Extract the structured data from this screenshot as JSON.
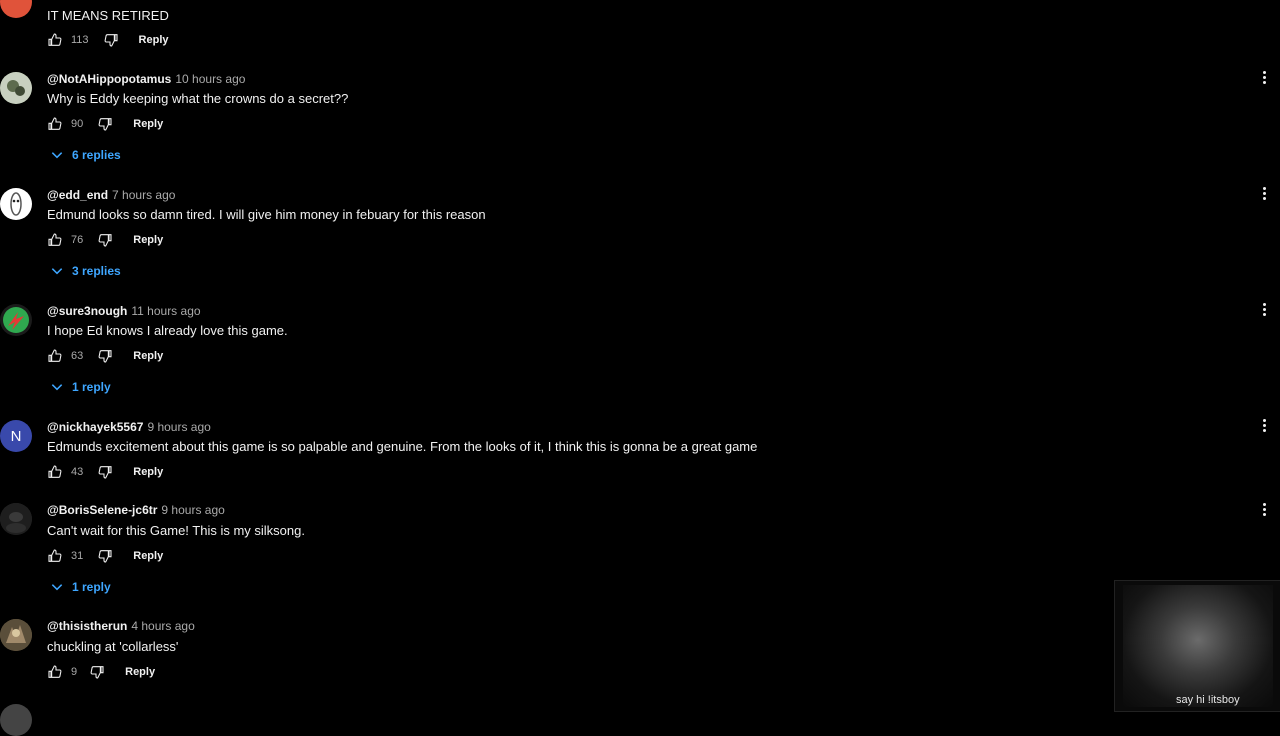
{
  "comments": [
    {
      "author": "",
      "time": "",
      "text": "IT MEANS RETIRED",
      "likes": "113",
      "reply_label": "Reply",
      "replies": "",
      "avatar_color": "#e0533a"
    },
    {
      "author": "@NotAHippopotamus",
      "time": "10 hours ago",
      "text": "Why is Eddy keeping what the crowns do a secret??",
      "likes": "90",
      "reply_label": "Reply",
      "replies": "6 replies",
      "avatar_color": "#8a9a7a"
    },
    {
      "author": "@edd_end",
      "time": "7 hours ago",
      "text": "Edmund looks so damn tired. I will give him money in febuary for this reason",
      "likes": "76",
      "reply_label": "Reply",
      "replies": "3 replies",
      "avatar_color": "#ffffff"
    },
    {
      "author": "@sure3nough",
      "time": "11 hours ago",
      "text": "I hope Ed knows I already love this game.",
      "likes": "63",
      "reply_label": "Reply",
      "replies": "1 reply",
      "avatar_color": "#2fa84f"
    },
    {
      "author": "@nickhayek5567",
      "time": "9 hours ago",
      "text": "Edmunds excitement about this game is so palpable and genuine. From the looks of it, I think this is gonna be a great game",
      "likes": "43",
      "reply_label": "Reply",
      "replies": "",
      "avatar_color": "#3949ab",
      "avatar_letter": "N"
    },
    {
      "author": "@BorisSelene-jc6tr",
      "time": "9 hours ago",
      "text": "Can't wait for this Game! This is my silksong.",
      "likes": "31",
      "reply_label": "Reply",
      "replies": "1 reply",
      "avatar_color": "#2a2a2a"
    },
    {
      "author": "@thisistherun",
      "time": "4 hours ago",
      "text": "chuckling at 'collarless'",
      "likes": "9",
      "reply_label": "Reply",
      "replies": "",
      "avatar_color": "#7a6a4a"
    }
  ],
  "webcam": {
    "caption": "say hi !itsboy"
  },
  "colors": {
    "background": "#000000",
    "link": "#3ea6ff",
    "text": "#f1f1f1",
    "muted": "#aaaaaa"
  }
}
